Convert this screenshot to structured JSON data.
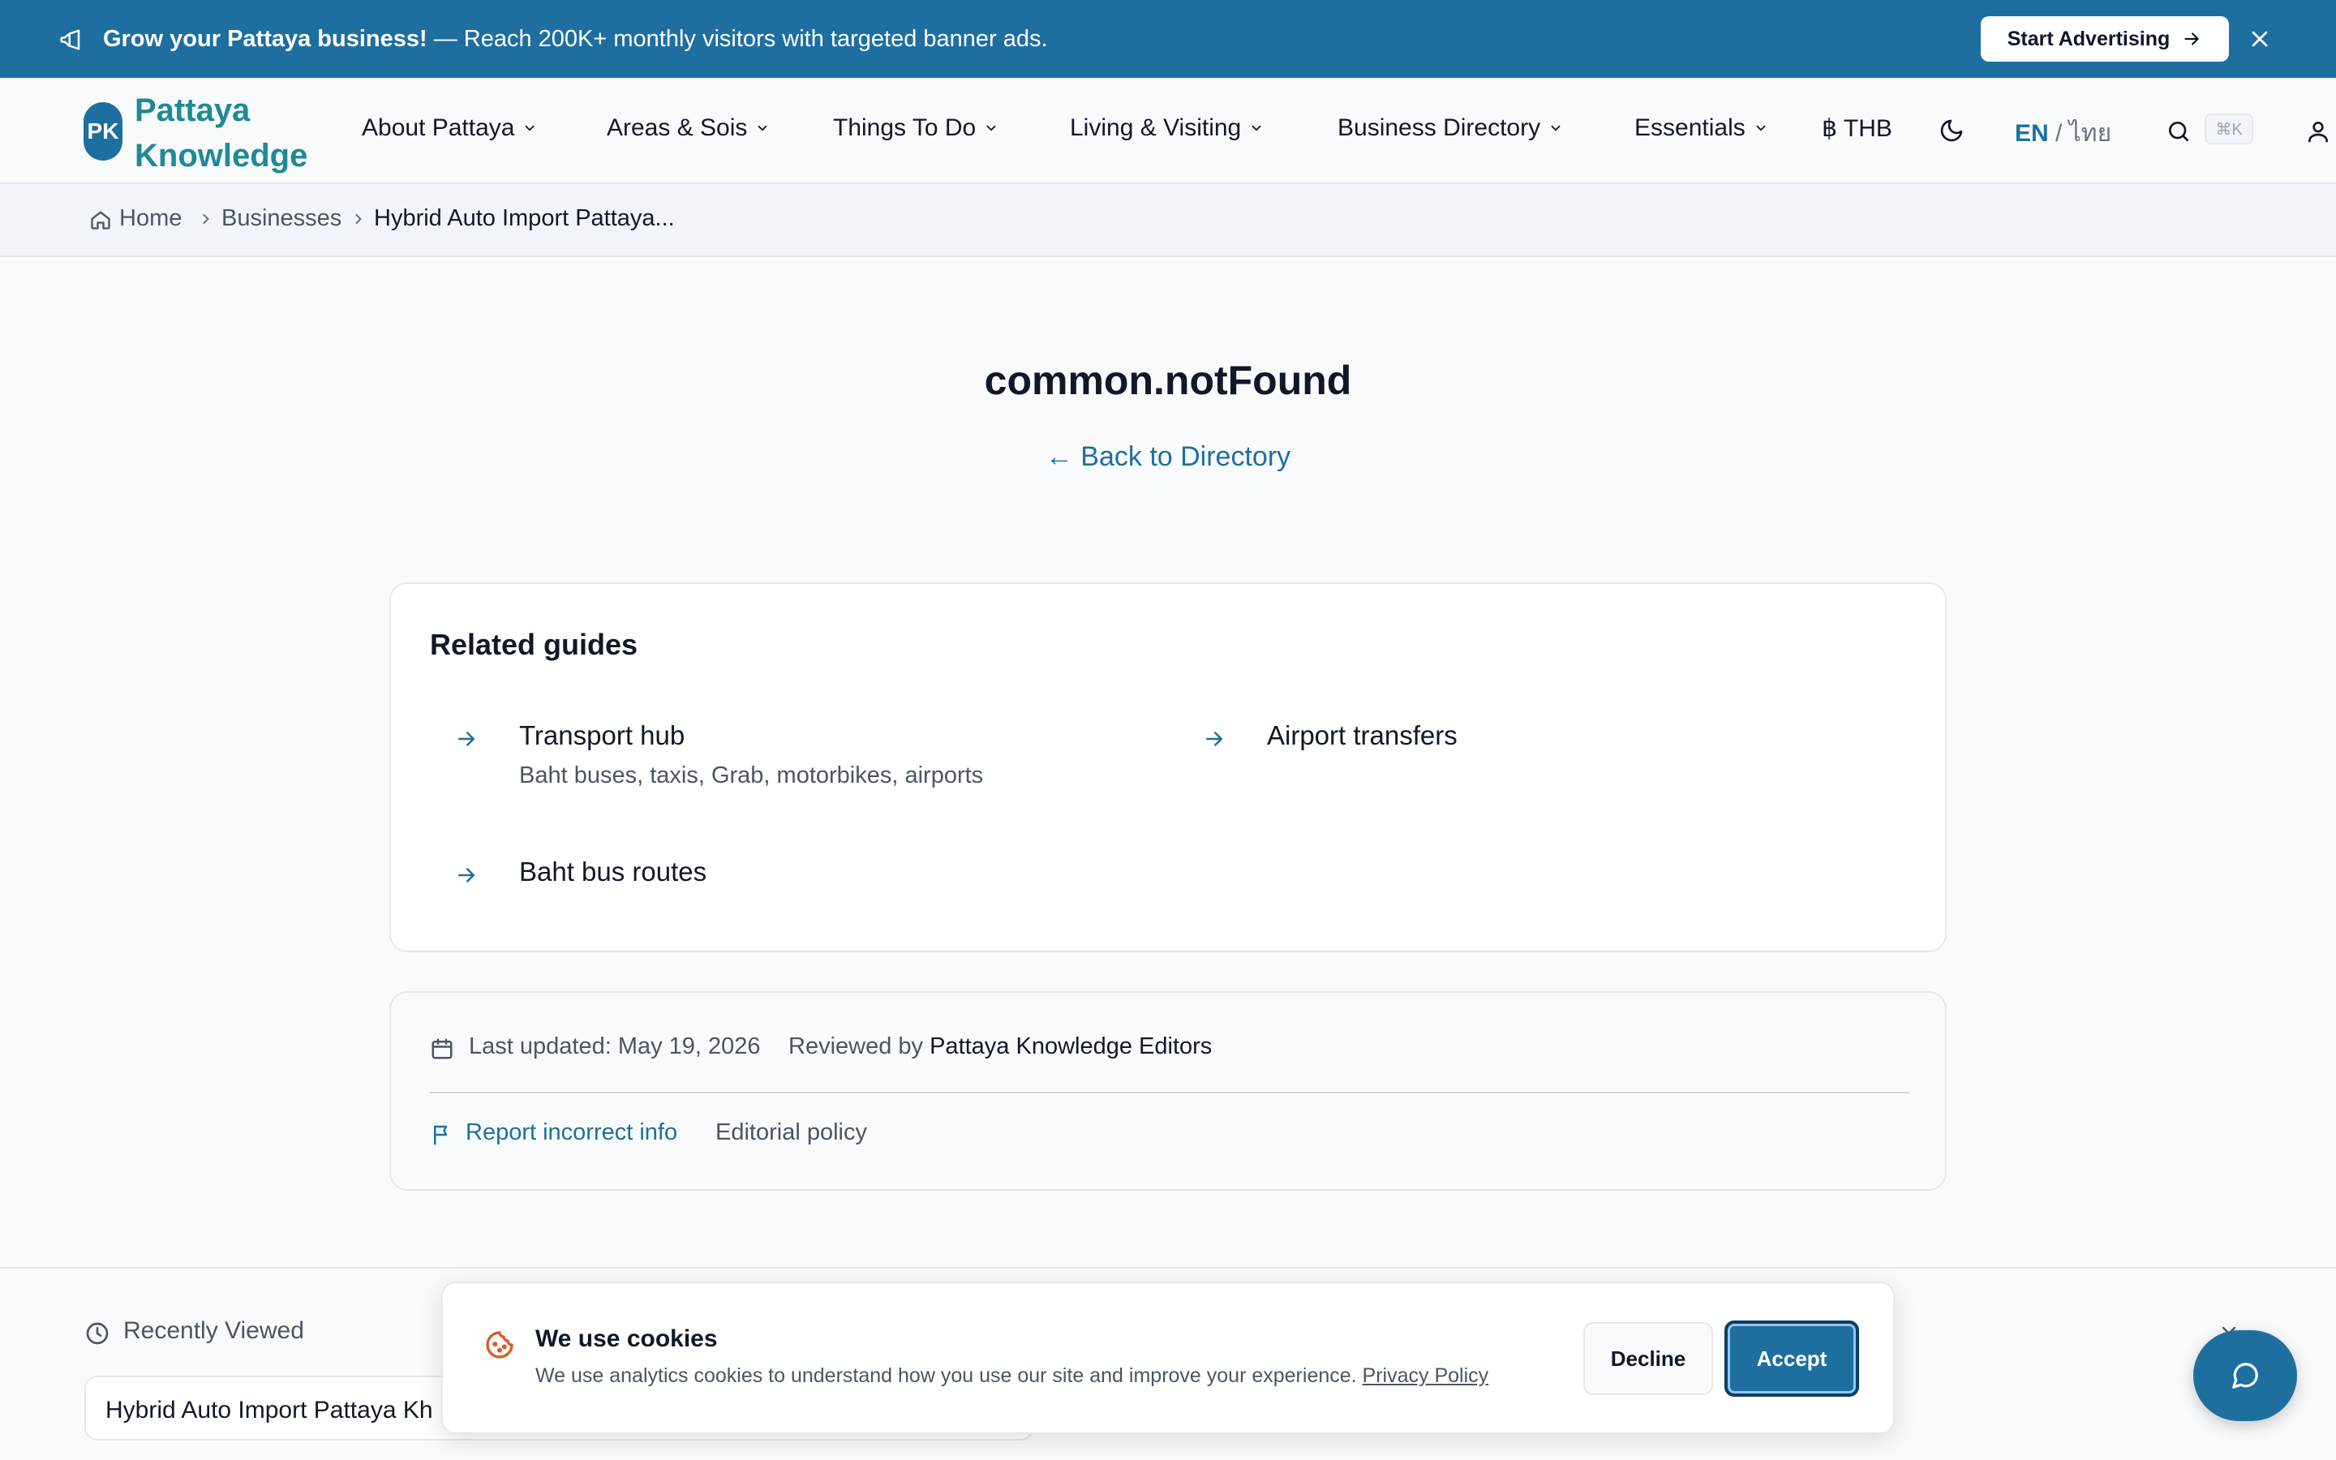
{
  "promo": {
    "bold": "Grow your Pattaya business!",
    "text": " — Reach 200K+ monthly visitors with targeted banner ads.",
    "cta": "Start Advertising"
  },
  "header": {
    "logo_badge": "PK",
    "logo_line1": "Pattaya",
    "logo_line2": "Knowledge",
    "nav": [
      {
        "label": "About Pattaya"
      },
      {
        "label": "Areas & Sois"
      },
      {
        "label": "Things To Do"
      },
      {
        "label": "Living & Visiting"
      },
      {
        "label": "Business Directory"
      },
      {
        "label": "Essentials"
      }
    ],
    "currency": "฿ THB",
    "lang_en": "EN",
    "lang_sep": " / ",
    "lang_th": "ไทย",
    "search_shortcut": "⌘K"
  },
  "breadcrumb": {
    "home": "Home",
    "businesses": "Businesses",
    "current": "Hybrid Auto Import Pattaya..."
  },
  "main": {
    "title": "common.notFound",
    "back_link": "← Back to Directory"
  },
  "guides": {
    "title": "Related guides",
    "items": [
      {
        "title": "Transport hub",
        "desc": "Baht buses, taxis, Grab, motorbikes, airports"
      },
      {
        "title": "Airport transfers",
        "desc": ""
      },
      {
        "title": "Baht bus routes",
        "desc": ""
      }
    ]
  },
  "meta": {
    "updated": "Last updated: May 19, 2026",
    "reviewed_prefix": "Reviewed by ",
    "reviewer": "Pattaya Knowledge Editors",
    "report": "Report incorrect info",
    "policy": "Editorial policy"
  },
  "recent": {
    "label": "Recently Viewed",
    "item": "Hybrid Auto Import Pattaya Kh"
  },
  "cookie": {
    "title": "We use cookies",
    "text": "We use analytics cookies to understand how you use our site and improve your experience. ",
    "privacy": "Privacy Policy",
    "decline": "Decline",
    "accept": "Accept"
  },
  "colors": {
    "brand": "#1e6f9f",
    "logo_text": "#1e8a96",
    "cookie_icon": "#e0572a"
  }
}
